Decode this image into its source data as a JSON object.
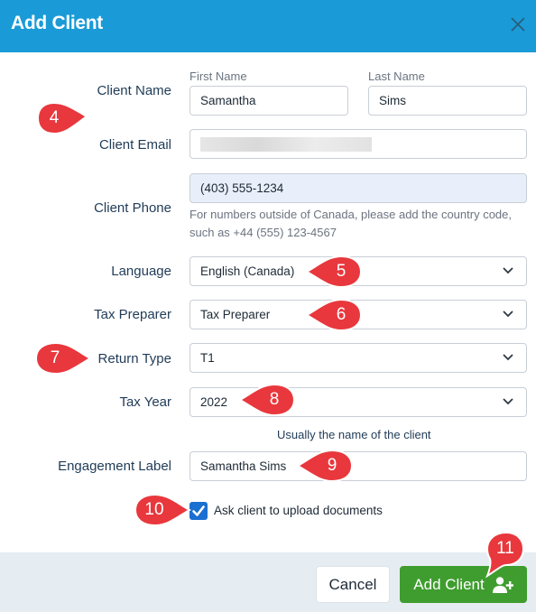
{
  "dialog": {
    "title": "Add Client",
    "close_icon": "close-icon"
  },
  "client_name": {
    "label": "Client Name",
    "first_label": "First Name",
    "last_label": "Last Name",
    "first_value": "Samantha",
    "last_value": "Sims"
  },
  "client_email": {
    "label": "Client Email"
  },
  "client_phone": {
    "label": "Client Phone",
    "value": "(403) 555-1234",
    "help_line1": "For numbers outside of Canada, please add the country code,",
    "help_line2": "such as +44 (555) 123-4567"
  },
  "language": {
    "label": "Language",
    "value": "English (Canada)"
  },
  "tax_preparer": {
    "label": "Tax Preparer",
    "value": "Tax Preparer"
  },
  "return_type": {
    "label": "Return Type",
    "value": "T1"
  },
  "tax_year": {
    "label": "Tax Year",
    "value": "2022"
  },
  "engagement": {
    "help": "Usually the name of the client",
    "label": "Engagement Label",
    "value": "Samantha Sims"
  },
  "upload": {
    "label": "Ask client to upload documents",
    "checked": true
  },
  "footer": {
    "cancel_label": "Cancel",
    "add_label": "Add Client"
  },
  "callouts": {
    "c4": "4",
    "c5": "5",
    "c6": "6",
    "c7": "7",
    "c8": "8",
    "c9": "9",
    "c10": "10",
    "c11": "11"
  },
  "colors": {
    "header": "#1a9bd7",
    "callout": "#e8383d",
    "primary_button": "#3f9d2f",
    "checkbox": "#1a6fd1"
  }
}
